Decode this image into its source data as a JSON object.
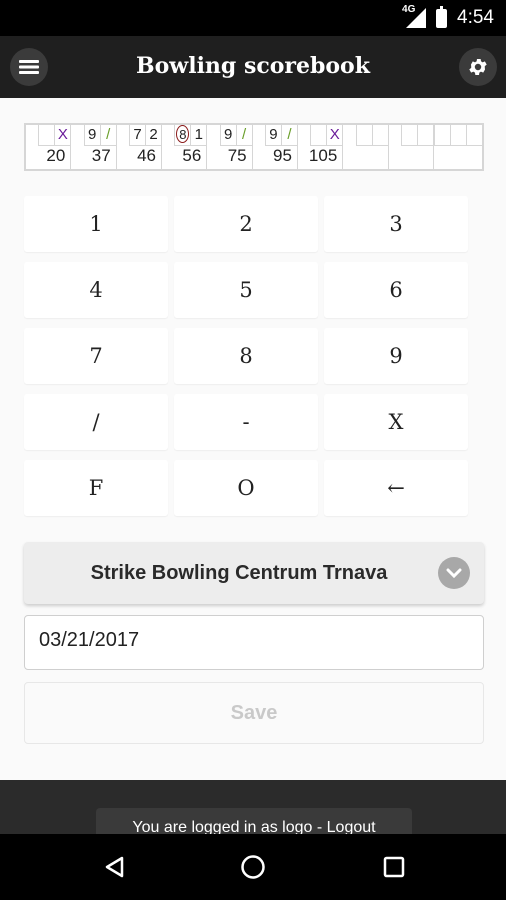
{
  "status_bar": {
    "network": "4G",
    "time": "4:54"
  },
  "toolbar": {
    "title": "Bowling scorebook",
    "menu_icon": "hamburger-menu-icon",
    "settings_icon": "gear-icon"
  },
  "scoresheet": {
    "frames": [
      {
        "balls": [
          "",
          "X"
        ],
        "total": "20"
      },
      {
        "balls": [
          "9",
          "/"
        ],
        "total": "37"
      },
      {
        "balls": [
          "7",
          "2"
        ],
        "total": "46"
      },
      {
        "balls": [
          "8",
          "1"
        ],
        "split_first": true,
        "total": "56"
      },
      {
        "balls": [
          "9",
          "/"
        ],
        "total": "75"
      },
      {
        "balls": [
          "9",
          "/"
        ],
        "total": "95"
      },
      {
        "balls": [
          "",
          "X"
        ],
        "total": "105"
      },
      {
        "balls": [
          "",
          ""
        ],
        "total": ""
      },
      {
        "balls": [
          "",
          ""
        ],
        "total": ""
      },
      {
        "balls": [
          "",
          "",
          ""
        ],
        "total": ""
      }
    ],
    "colors": {
      "strike": "#6a1b9a",
      "spare": "#6a9f2a",
      "split_ring": "#8b1c1c"
    }
  },
  "keypad": {
    "keys": [
      "1",
      "2",
      "3",
      "4",
      "5",
      "6",
      "7",
      "8",
      "9",
      "/",
      "-",
      "X",
      "F",
      "O",
      "←"
    ]
  },
  "alley_select": {
    "selected": "Strike Bowling Centrum Trnava",
    "icon": "chevron-down-icon"
  },
  "date_field": {
    "value": "03/21/2017"
  },
  "save_button": {
    "label": "Save"
  },
  "login_toast": {
    "text": "You are logged in as logo - Logout"
  },
  "nav_bar": {
    "back_icon": "back-icon",
    "home_icon": "home-icon",
    "recents_icon": "recents-icon"
  }
}
